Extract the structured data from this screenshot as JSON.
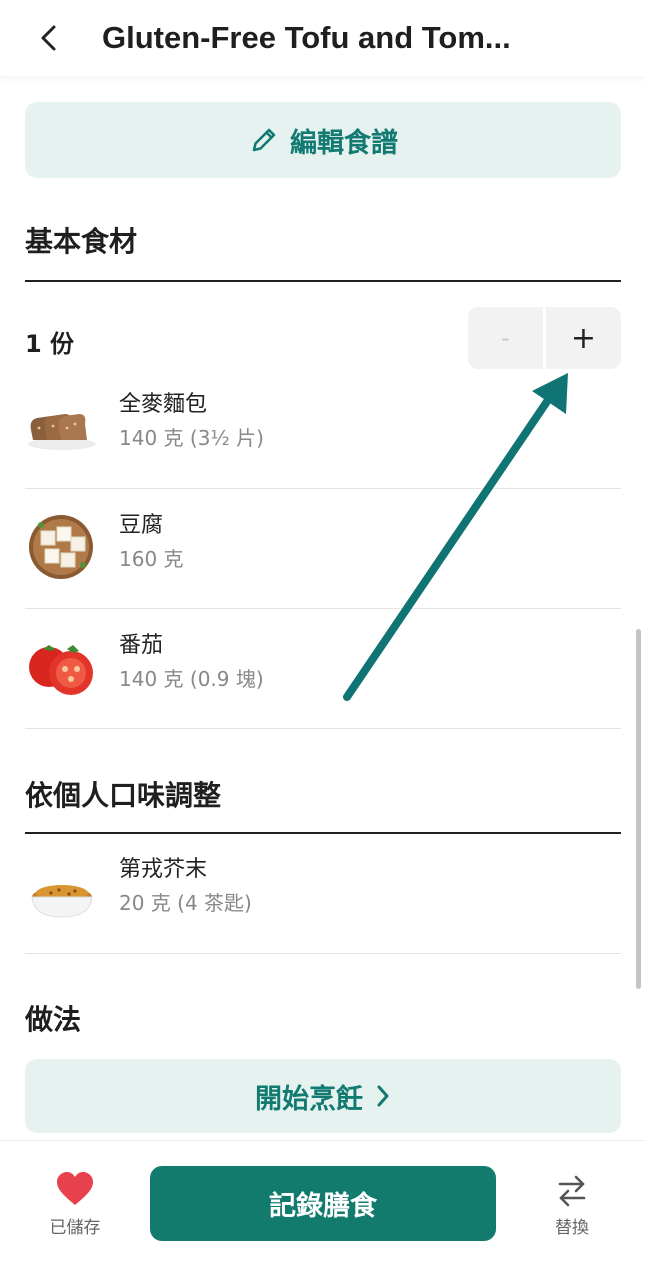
{
  "header": {
    "title": "Gluten-Free Tofu and Tom...",
    "back_icon": "chevron-left-icon"
  },
  "edit_button": {
    "label": "編輯食譜",
    "icon": "pencil-icon"
  },
  "sections": {
    "basic_ingredients": "基本食材",
    "adjust_to_taste": "依個人口味調整",
    "method": "做法"
  },
  "servings": {
    "label": "1 份",
    "minus": "-",
    "plus": "+"
  },
  "ingredients": [
    {
      "name": "全麥麵包",
      "qty": "140 克 (3½ 片)",
      "icon": "bread-icon"
    },
    {
      "name": "豆腐",
      "qty": "160 克",
      "icon": "tofu-icon"
    },
    {
      "name": "番茄",
      "qty": "140 克 (0.9 塊)",
      "icon": "tomato-icon"
    }
  ],
  "optional_ingredients": [
    {
      "name": "第戎芥末",
      "qty": "20 克 (4 茶匙)",
      "icon": "mustard-icon"
    }
  ],
  "start_button": {
    "label": "開始烹飪",
    "icon": "chevron-right-icon"
  },
  "bottom_bar": {
    "saved_label": "已儲存",
    "log_label": "記錄膳食",
    "swap_label": "替換"
  },
  "colors": {
    "accent": "#137a6e",
    "accent_light": "#e6f2f0",
    "heart": "#e8414e",
    "annotation_arrow": "#117474"
  }
}
